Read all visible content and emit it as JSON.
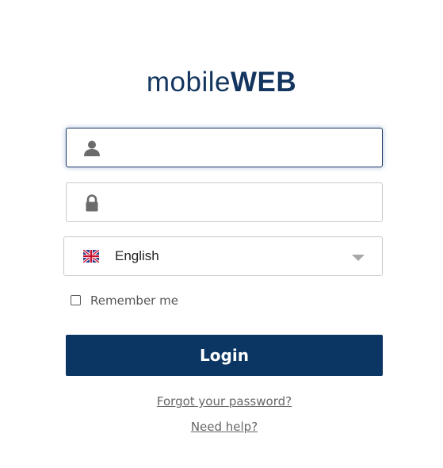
{
  "logo": {
    "light": "mobile",
    "bold": "WEB"
  },
  "login_form": {
    "username": {
      "value": "",
      "placeholder": "",
      "icon": "user-icon"
    },
    "password": {
      "value": "",
      "placeholder": "",
      "icon": "lock-icon"
    },
    "language": {
      "selected": "English",
      "flag": "uk-flag-icon"
    },
    "remember_label": "Remember me",
    "login_label": "Login",
    "forgot_label": "Forgot your password?",
    "help_label": "Need help?"
  },
  "colors": {
    "brand": "#13355f",
    "button": "#0b3563",
    "focus_border": "#1d3a66",
    "border": "#c9c9c9",
    "link": "#666666"
  }
}
